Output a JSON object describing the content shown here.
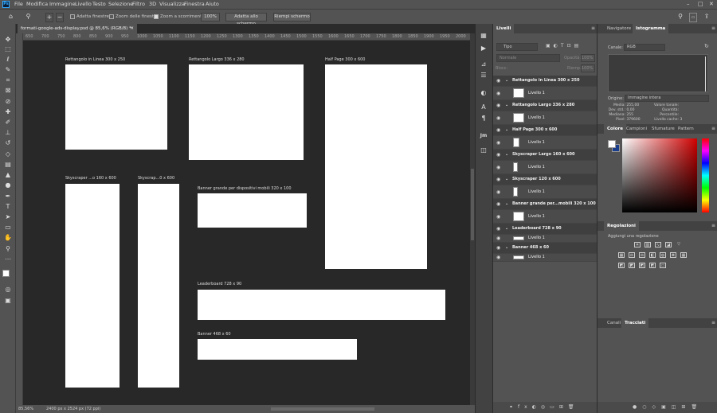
{
  "app": {
    "logo": "Ps"
  },
  "menu": [
    "File",
    "Modifica",
    "Immagine",
    "Livello",
    "Testo",
    "Selezione",
    "Filtro",
    "3D",
    "Visualizza",
    "Finestra",
    "Aiuto"
  ],
  "options": {
    "adatta_finestre": "Adatta finestre",
    "zoom_delle_finestre": "Zoom delle finestre",
    "zoom_scorrimento": "Zoom a scorrimento",
    "zoom_value": "100%",
    "adatta_schermo": "Adatta allo schermo",
    "riempi_schermo": "Riempi schermo"
  },
  "document": {
    "tab_title": "formati-google-ads-display.psd @ 85,6% (RGB/8) *"
  },
  "ruler": {
    "ticks": [
      "650",
      "700",
      "750",
      "800",
      "850",
      "900",
      "950",
      "1000",
      "1050",
      "1100",
      "1150",
      "1200",
      "1250",
      "1300",
      "1350",
      "1400",
      "1450",
      "1500",
      "1550",
      "1600",
      "1650",
      "1700",
      "1750",
      "1800",
      "1850",
      "1900",
      "1950",
      "2000"
    ]
  },
  "artboards": [
    {
      "label": "Rettangolo in Linea 300 x 250"
    },
    {
      "label": "Rettangolo Largo 336 x 280"
    },
    {
      "label": "Half Page 300 x 600"
    },
    {
      "label": "Skyscraper ...o 160 x 600"
    },
    {
      "label": "Skyscrap...0 x 600"
    },
    {
      "label": "Banner grande per dispositivi mobili 320 x 100"
    },
    {
      "label": "Leaderboard 728 x 90"
    },
    {
      "label": "Banner 468 x 60"
    }
  ],
  "status": {
    "zoom": "85,56%",
    "doc_info": "2400 px x 2524 px (72 ppi)"
  },
  "layers_panel": {
    "tabs": [
      "Livelli"
    ],
    "filter": "Tipo",
    "blend": "Normale",
    "opacity_label": "Opacità:",
    "opacity": "100%",
    "lock_label": "Blocc:",
    "fill_label": "Riemp.:",
    "fill": "100%",
    "rows": [
      {
        "type": "group",
        "name": "Rettangolo in Linea 300 x 250"
      },
      {
        "type": "layer",
        "name": "Livello 1"
      },
      {
        "type": "group",
        "name": "Rettangolo Largo 336 x 280"
      },
      {
        "type": "layer",
        "name": "Livello 1"
      },
      {
        "type": "group",
        "name": "Half Page 300 x 600"
      },
      {
        "type": "layer",
        "name": "Livello 1"
      },
      {
        "type": "group",
        "name": "Skyscraper Largo 160 x 600"
      },
      {
        "type": "layer",
        "name": "Livello 1"
      },
      {
        "type": "group",
        "name": "Skyscraper 120 x 600"
      },
      {
        "type": "layer",
        "name": "Livello 1"
      },
      {
        "type": "group",
        "name": "Banner grande per...mobili 320 x 100"
      },
      {
        "type": "layer",
        "name": "Livello 1"
      },
      {
        "type": "group",
        "name": "Leaderboard 728 x 90"
      },
      {
        "type": "layer",
        "name": "Livello 1"
      },
      {
        "type": "group",
        "name": "Banner 468 x 60"
      },
      {
        "type": "layer",
        "name": "Livello 1"
      }
    ]
  },
  "navigator": {
    "tabs": [
      "Navigatore",
      "Istogramma"
    ],
    "canale_label": "Canale:",
    "canale": "RGB",
    "origine_label": "Origine:",
    "origine": "Immagine intera",
    "stats_left": [
      [
        "Media:",
        "255,00"
      ],
      [
        "Dev. std.:",
        "0,00"
      ],
      [
        "Mediana:",
        "255"
      ],
      [
        "Pixel:",
        "379600"
      ]
    ],
    "stats_right": [
      [
        "Valore tonale:",
        ""
      ],
      [
        "Quantità:",
        ""
      ],
      [
        "Percentile:",
        ""
      ],
      [
        "Livello cache:",
        "3"
      ]
    ]
  },
  "color_panel": {
    "tabs": [
      "Colore",
      "Campioni",
      "Sfumature",
      "Pattern"
    ]
  },
  "adjust_panel": {
    "title": "Regolazioni",
    "hint": "Aggiungi una regolazione"
  },
  "paths_panel": {
    "tabs": [
      "Canali",
      "Tracciati"
    ]
  }
}
